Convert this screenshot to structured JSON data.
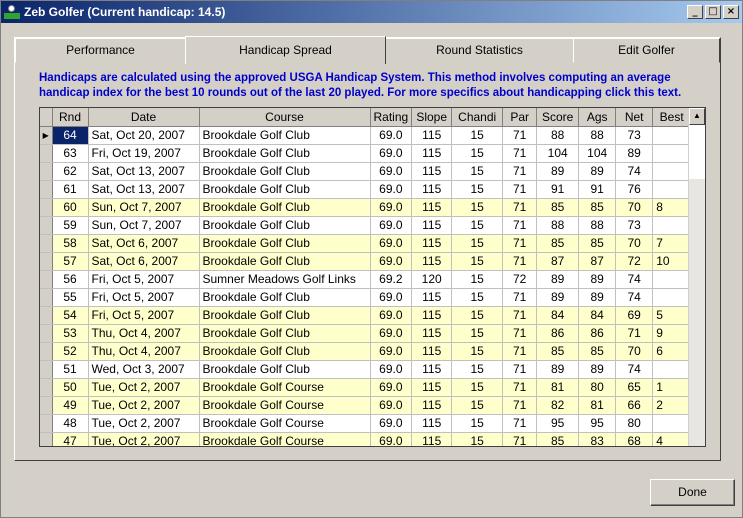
{
  "window": {
    "title": "Zeb Golfer (Current handicap: 14.5)"
  },
  "title_controls": {
    "minimize": "_",
    "maximize": "□",
    "close": "×"
  },
  "tabs": [
    {
      "label": "Performance"
    },
    {
      "label": "Handicap Spread"
    },
    {
      "label": "Round Statistics"
    },
    {
      "label": "Edit Golfer"
    }
  ],
  "info_text": "Handicaps are calculated using the approved USGA Handicap System. This method involves computing an average handicap index for the best 10 rounds out of the last 20 played. For more specifics about handicapping click this text.",
  "table": {
    "headers": [
      "Rnd",
      "Date",
      "Course",
      "Rating",
      "Slope",
      "Chandi",
      "Par",
      "Score",
      "Ags",
      "Net",
      "Best"
    ],
    "rows": [
      {
        "rnd": "64",
        "date": "Sat, Oct 20, 2007",
        "course": "Brookdale Golf Club",
        "rating": "69.0",
        "slope": "115",
        "chandi": "15",
        "par": "71",
        "score": "88",
        "ags": "88",
        "net": "73",
        "best": "",
        "highlight": false
      },
      {
        "rnd": "63",
        "date": "Fri, Oct 19, 2007",
        "course": "Brookdale Golf Club",
        "rating": "69.0",
        "slope": "115",
        "chandi": "15",
        "par": "71",
        "score": "104",
        "ags": "104",
        "net": "89",
        "best": "",
        "highlight": false
      },
      {
        "rnd": "62",
        "date": "Sat, Oct 13, 2007",
        "course": "Brookdale Golf Club",
        "rating": "69.0",
        "slope": "115",
        "chandi": "15",
        "par": "71",
        "score": "89",
        "ags": "89",
        "net": "74",
        "best": "",
        "highlight": false
      },
      {
        "rnd": "61",
        "date": "Sat, Oct 13, 2007",
        "course": "Brookdale Golf Club",
        "rating": "69.0",
        "slope": "115",
        "chandi": "15",
        "par": "71",
        "score": "91",
        "ags": "91",
        "net": "76",
        "best": "",
        "highlight": false
      },
      {
        "rnd": "60",
        "date": "Sun, Oct 7, 2007",
        "course": "Brookdale Golf Club",
        "rating": "69.0",
        "slope": "115",
        "chandi": "15",
        "par": "71",
        "score": "85",
        "ags": "85",
        "net": "70",
        "best": "8",
        "highlight": true
      },
      {
        "rnd": "59",
        "date": "Sun, Oct 7, 2007",
        "course": "Brookdale Golf Club",
        "rating": "69.0",
        "slope": "115",
        "chandi": "15",
        "par": "71",
        "score": "88",
        "ags": "88",
        "net": "73",
        "best": "",
        "highlight": false
      },
      {
        "rnd": "58",
        "date": "Sat, Oct 6, 2007",
        "course": "Brookdale Golf Club",
        "rating": "69.0",
        "slope": "115",
        "chandi": "15",
        "par": "71",
        "score": "85",
        "ags": "85",
        "net": "70",
        "best": "7",
        "highlight": true
      },
      {
        "rnd": "57",
        "date": "Sat, Oct 6, 2007",
        "course": "Brookdale Golf Club",
        "rating": "69.0",
        "slope": "115",
        "chandi": "15",
        "par": "71",
        "score": "87",
        "ags": "87",
        "net": "72",
        "best": "10",
        "highlight": true
      },
      {
        "rnd": "56",
        "date": "Fri, Oct 5, 2007",
        "course": "Sumner Meadows Golf Links",
        "rating": "69.2",
        "slope": "120",
        "chandi": "15",
        "par": "72",
        "score": "89",
        "ags": "89",
        "net": "74",
        "best": "",
        "highlight": false
      },
      {
        "rnd": "55",
        "date": "Fri, Oct 5, 2007",
        "course": "Brookdale Golf Club",
        "rating": "69.0",
        "slope": "115",
        "chandi": "15",
        "par": "71",
        "score": "89",
        "ags": "89",
        "net": "74",
        "best": "",
        "highlight": false
      },
      {
        "rnd": "54",
        "date": "Fri, Oct 5, 2007",
        "course": "Brookdale Golf Club",
        "rating": "69.0",
        "slope": "115",
        "chandi": "15",
        "par": "71",
        "score": "84",
        "ags": "84",
        "net": "69",
        "best": "5",
        "highlight": true
      },
      {
        "rnd": "53",
        "date": "Thu, Oct 4, 2007",
        "course": "Brookdale Golf Club",
        "rating": "69.0",
        "slope": "115",
        "chandi": "15",
        "par": "71",
        "score": "86",
        "ags": "86",
        "net": "71",
        "best": "9",
        "highlight": true
      },
      {
        "rnd": "52",
        "date": "Thu, Oct 4, 2007",
        "course": "Brookdale Golf Club",
        "rating": "69.0",
        "slope": "115",
        "chandi": "15",
        "par": "71",
        "score": "85",
        "ags": "85",
        "net": "70",
        "best": "6",
        "highlight": true
      },
      {
        "rnd": "51",
        "date": "Wed, Oct 3, 2007",
        "course": "Brookdale Golf Club",
        "rating": "69.0",
        "slope": "115",
        "chandi": "15",
        "par": "71",
        "score": "89",
        "ags": "89",
        "net": "74",
        "best": "",
        "highlight": false
      },
      {
        "rnd": "50",
        "date": "Tue, Oct 2, 2007",
        "course": "Brookdale Golf Course",
        "rating": "69.0",
        "slope": "115",
        "chandi": "15",
        "par": "71",
        "score": "81",
        "ags": "80",
        "net": "65",
        "best": "1",
        "highlight": true
      },
      {
        "rnd": "49",
        "date": "Tue, Oct 2, 2007",
        "course": "Brookdale Golf Course",
        "rating": "69.0",
        "slope": "115",
        "chandi": "15",
        "par": "71",
        "score": "82",
        "ags": "81",
        "net": "66",
        "best": "2",
        "highlight": true
      },
      {
        "rnd": "48",
        "date": "Tue, Oct 2, 2007",
        "course": "Brookdale Golf Course",
        "rating": "69.0",
        "slope": "115",
        "chandi": "15",
        "par": "71",
        "score": "95",
        "ags": "95",
        "net": "80",
        "best": "",
        "highlight": false
      },
      {
        "rnd": "47",
        "date": "Tue, Oct 2, 2007",
        "course": "Brookdale Golf Course",
        "rating": "69.0",
        "slope": "115",
        "chandi": "15",
        "par": "71",
        "score": "85",
        "ags": "83",
        "net": "68",
        "best": "4",
        "highlight": true
      }
    ]
  },
  "colors": {
    "highlight_row": "#ffffcc",
    "info_text": "#0000cc",
    "selected_cell": "#0a246a"
  },
  "done_button": {
    "label": "Done"
  }
}
